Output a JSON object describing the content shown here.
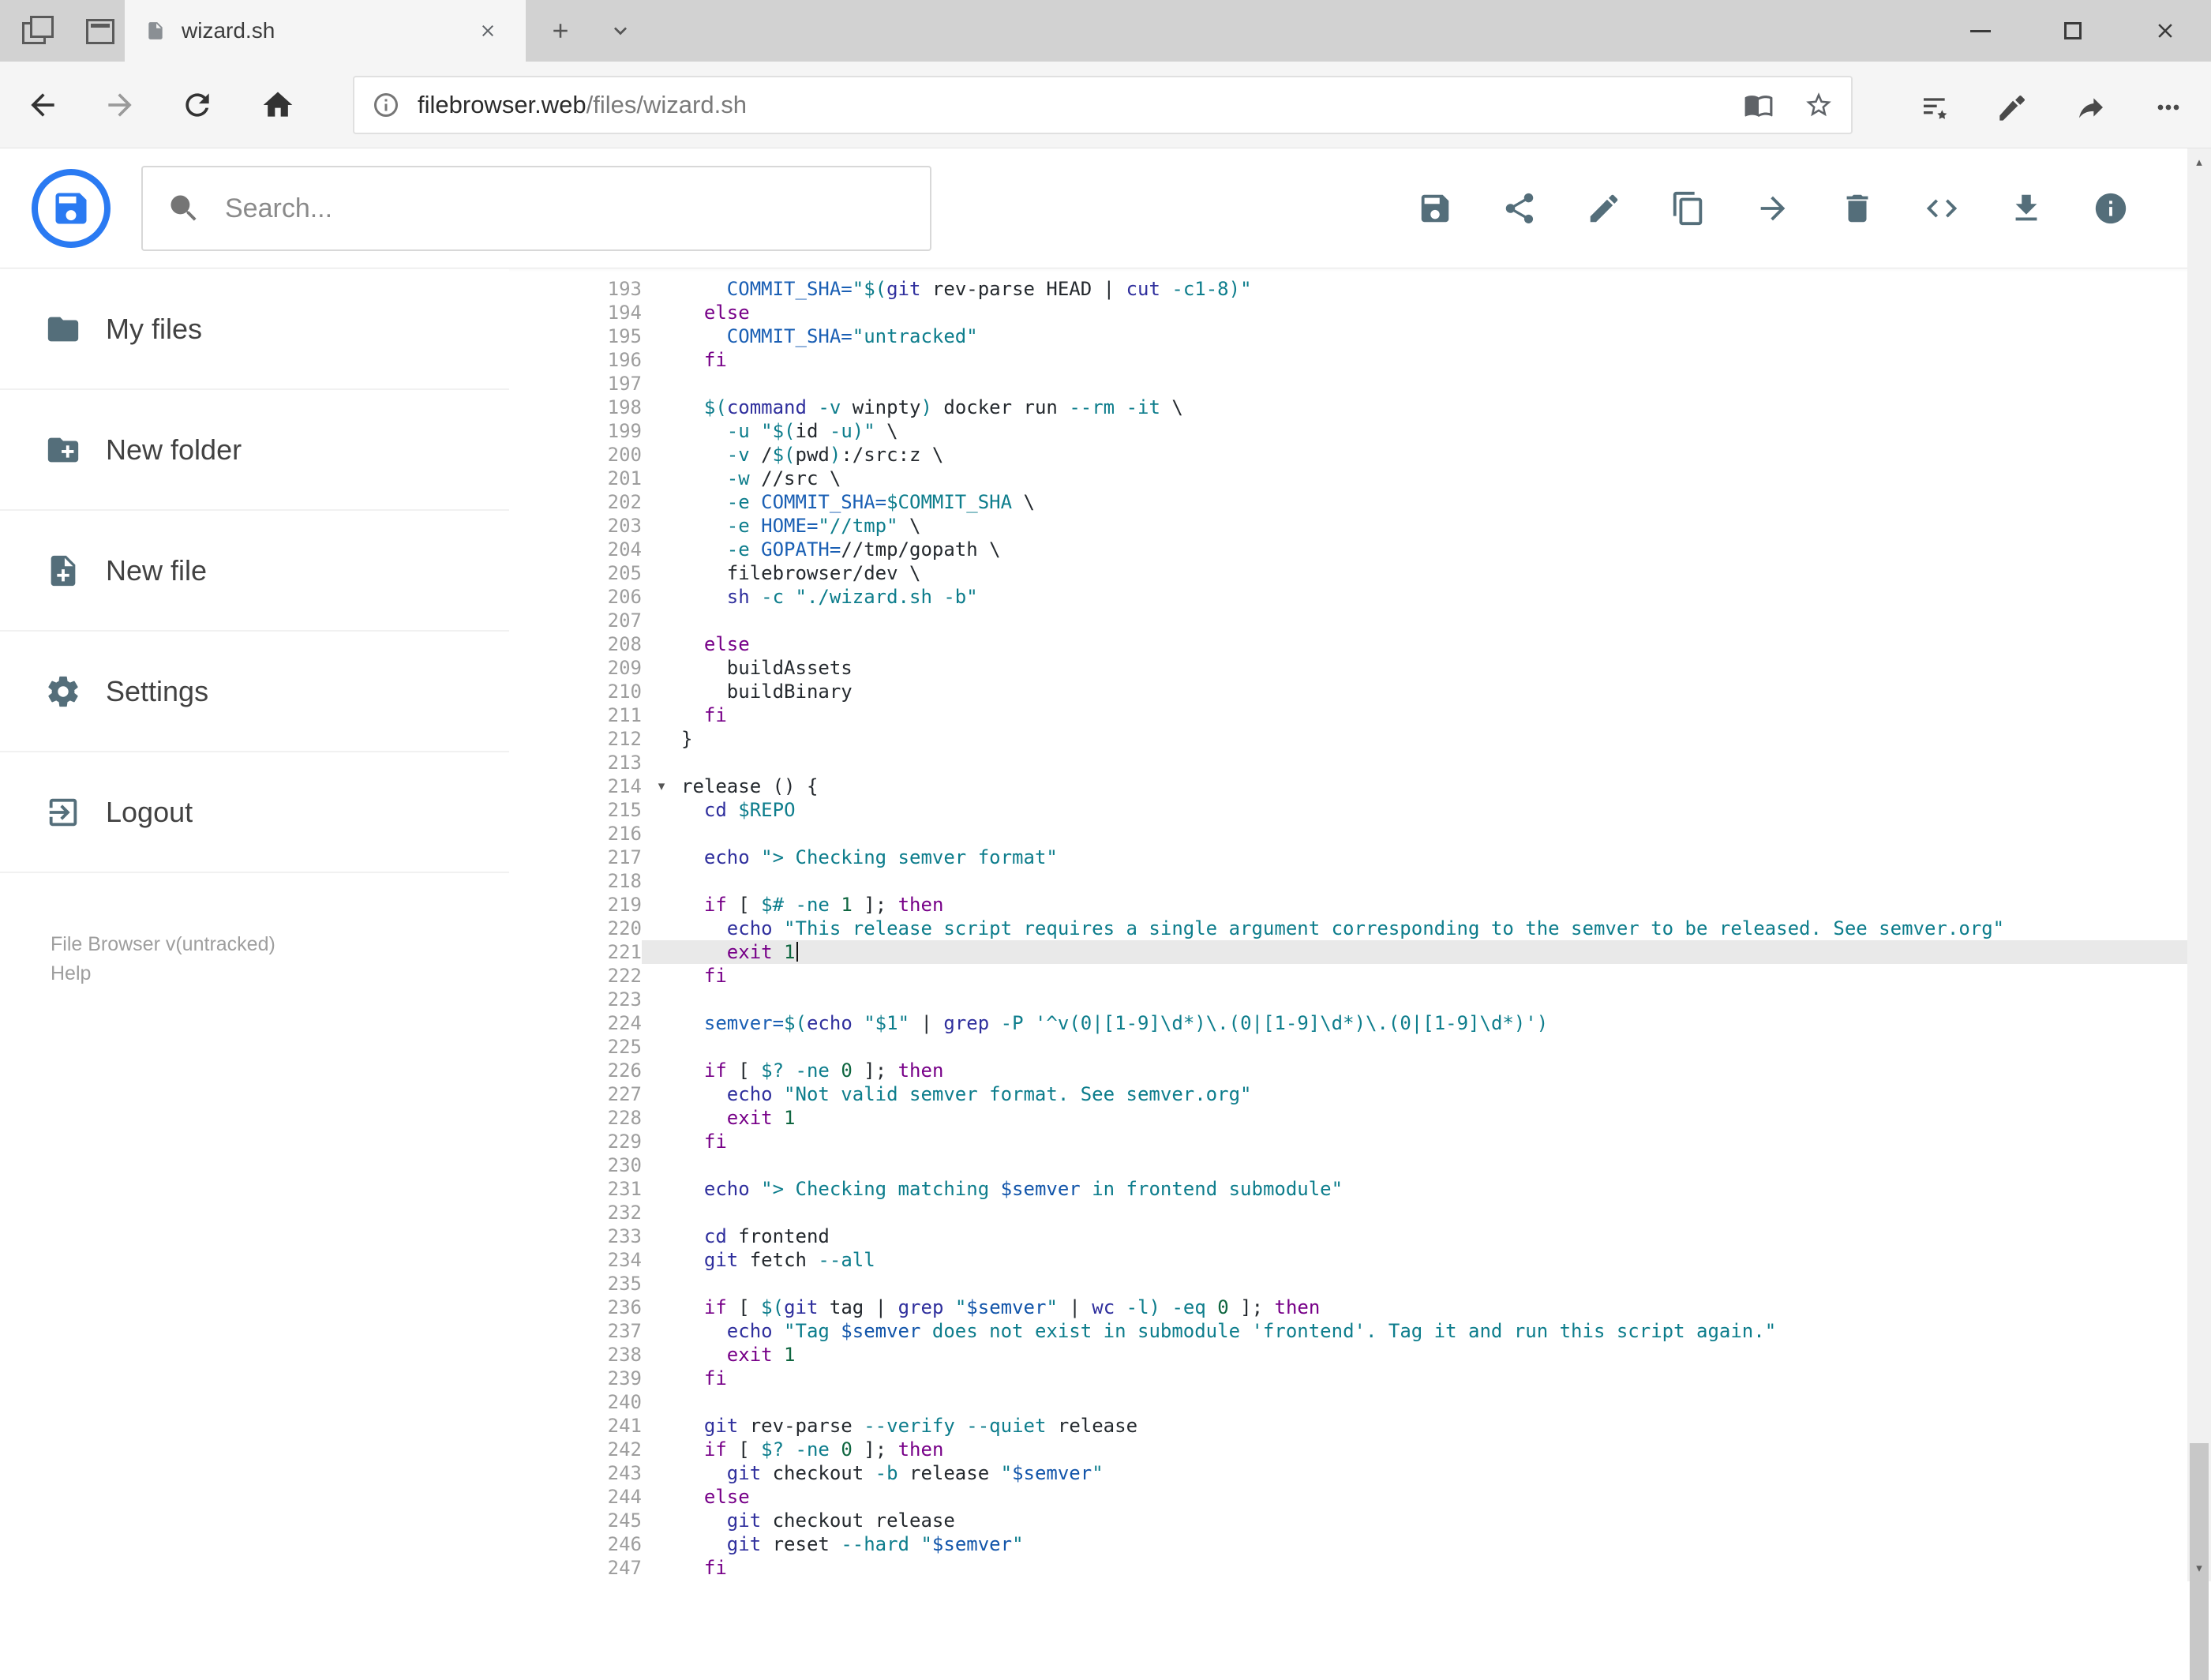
{
  "browser": {
    "tab_title": "wizard.sh",
    "url_host": "filebrowser.web",
    "url_path": "/files/wizard.sh"
  },
  "header": {
    "search_placeholder": "Search...",
    "actions": [
      {
        "name": "save",
        "icon": "save"
      },
      {
        "name": "share",
        "icon": "share"
      },
      {
        "name": "rename",
        "icon": "edit"
      },
      {
        "name": "copy",
        "icon": "copy"
      },
      {
        "name": "move",
        "icon": "move"
      },
      {
        "name": "delete",
        "icon": "delete"
      },
      {
        "name": "editor",
        "icon": "code"
      },
      {
        "name": "download",
        "icon": "download"
      },
      {
        "name": "info",
        "icon": "info"
      }
    ]
  },
  "sidebar": {
    "items": [
      {
        "name": "my-files",
        "icon": "folder",
        "label": "My files"
      },
      {
        "name": "new-folder",
        "icon": "new-folder",
        "label": "New folder"
      },
      {
        "name": "new-file",
        "icon": "new-file",
        "label": "New file"
      },
      {
        "name": "settings",
        "icon": "settings",
        "label": "Settings"
      },
      {
        "name": "logout",
        "icon": "logout",
        "label": "Logout"
      }
    ],
    "footer_version": "File Browser v(untracked)",
    "footer_help": "Help"
  },
  "colors": {
    "accent": "#2a7af2",
    "icon_gray": "#546e7a",
    "active_line_bg": "#e9e9e9",
    "keyword": "#770088",
    "string": "#0d7d8c"
  },
  "editor": {
    "active_line": 221,
    "fold_line": 214,
    "lines": [
      {
        "n": 193,
        "t": [
          [
            "p",
            "    "
          ],
          [
            "d",
            "COMMIT_SHA="
          ],
          [
            "s",
            "\""
          ],
          [
            "v",
            "$("
          ],
          [
            "b",
            "git"
          ],
          [
            "p",
            " rev-parse HEAD | "
          ],
          [
            "b",
            "cut"
          ],
          [
            "p",
            " "
          ],
          [
            "a",
            "-c1-8"
          ],
          [
            "v",
            ")"
          ],
          [
            "s",
            "\""
          ]
        ]
      },
      {
        "n": 194,
        "t": [
          [
            "p",
            "  "
          ],
          [
            "k",
            "else"
          ]
        ]
      },
      {
        "n": 195,
        "t": [
          [
            "p",
            "    "
          ],
          [
            "d",
            "COMMIT_SHA="
          ],
          [
            "s",
            "\"untracked\""
          ]
        ]
      },
      {
        "n": 196,
        "t": [
          [
            "p",
            "  "
          ],
          [
            "k",
            "fi"
          ]
        ]
      },
      {
        "n": 197,
        "t": []
      },
      {
        "n": 198,
        "t": [
          [
            "p",
            "  "
          ],
          [
            "v",
            "$("
          ],
          [
            "b",
            "command"
          ],
          [
            "p",
            " "
          ],
          [
            "a",
            "-v"
          ],
          [
            "p",
            " winpty"
          ],
          [
            "v",
            ")"
          ],
          [
            "p",
            " docker run "
          ],
          [
            "a",
            "--rm"
          ],
          [
            "p",
            " "
          ],
          [
            "a",
            "-it"
          ],
          [
            "p",
            " \\"
          ]
        ]
      },
      {
        "n": 199,
        "t": [
          [
            "p",
            "    "
          ],
          [
            "a",
            "-u"
          ],
          [
            "p",
            " "
          ],
          [
            "s",
            "\""
          ],
          [
            "v",
            "$("
          ],
          [
            "p",
            "id "
          ],
          [
            "a",
            "-u"
          ],
          [
            "v",
            ")"
          ],
          [
            "s",
            "\""
          ],
          [
            "p",
            " \\"
          ]
        ]
      },
      {
        "n": 200,
        "t": [
          [
            "p",
            "    "
          ],
          [
            "a",
            "-v"
          ],
          [
            "p",
            " /"
          ],
          [
            "v",
            "$("
          ],
          [
            "p",
            "pwd"
          ],
          [
            "v",
            ")"
          ],
          [
            "p",
            ":/src:z \\"
          ]
        ]
      },
      {
        "n": 201,
        "t": [
          [
            "p",
            "    "
          ],
          [
            "a",
            "-w"
          ],
          [
            "p",
            " //src \\"
          ]
        ]
      },
      {
        "n": 202,
        "t": [
          [
            "p",
            "    "
          ],
          [
            "a",
            "-e"
          ],
          [
            "p",
            " "
          ],
          [
            "d",
            "COMMIT_SHA="
          ],
          [
            "v",
            "$COMMIT_SHA"
          ],
          [
            "p",
            " \\"
          ]
        ]
      },
      {
        "n": 203,
        "t": [
          [
            "p",
            "    "
          ],
          [
            "a",
            "-e"
          ],
          [
            "p",
            " "
          ],
          [
            "d",
            "HOME="
          ],
          [
            "s",
            "\"//tmp\""
          ],
          [
            "p",
            " \\"
          ]
        ]
      },
      {
        "n": 204,
        "t": [
          [
            "p",
            "    "
          ],
          [
            "a",
            "-e"
          ],
          [
            "p",
            " "
          ],
          [
            "d",
            "GOPATH="
          ],
          [
            "p",
            "//tmp/gopath \\"
          ]
        ]
      },
      {
        "n": 205,
        "t": [
          [
            "p",
            "    filebrowser/dev \\"
          ]
        ]
      },
      {
        "n": 206,
        "t": [
          [
            "p",
            "    "
          ],
          [
            "b",
            "sh"
          ],
          [
            "p",
            " "
          ],
          [
            "a",
            "-c"
          ],
          [
            "p",
            " "
          ],
          [
            "s",
            "\"./wizard.sh -b\""
          ]
        ]
      },
      {
        "n": 207,
        "t": []
      },
      {
        "n": 208,
        "t": [
          [
            "p",
            "  "
          ],
          [
            "k",
            "else"
          ]
        ]
      },
      {
        "n": 209,
        "t": [
          [
            "p",
            "    buildAssets"
          ]
        ]
      },
      {
        "n": 210,
        "t": [
          [
            "p",
            "    buildBinary"
          ]
        ]
      },
      {
        "n": 211,
        "t": [
          [
            "p",
            "  "
          ],
          [
            "k",
            "fi"
          ]
        ]
      },
      {
        "n": 212,
        "t": [
          [
            "p",
            "}"
          ]
        ]
      },
      {
        "n": 213,
        "t": []
      },
      {
        "n": 214,
        "t": [
          [
            "p",
            "release () {"
          ]
        ]
      },
      {
        "n": 215,
        "t": [
          [
            "p",
            "  "
          ],
          [
            "b",
            "cd"
          ],
          [
            "p",
            " "
          ],
          [
            "v",
            "$REPO"
          ]
        ]
      },
      {
        "n": 216,
        "t": []
      },
      {
        "n": 217,
        "t": [
          [
            "p",
            "  "
          ],
          [
            "b",
            "echo"
          ],
          [
            "p",
            " "
          ],
          [
            "s",
            "\"> Checking semver format\""
          ]
        ]
      },
      {
        "n": 218,
        "t": []
      },
      {
        "n": 219,
        "t": [
          [
            "p",
            "  "
          ],
          [
            "k",
            "if"
          ],
          [
            "p",
            " [ "
          ],
          [
            "v",
            "$#"
          ],
          [
            "p",
            " "
          ],
          [
            "a",
            "-ne"
          ],
          [
            "p",
            " "
          ],
          [
            "num",
            "1"
          ],
          [
            "p",
            " ]; "
          ],
          [
            "k",
            "then"
          ]
        ]
      },
      {
        "n": 220,
        "t": [
          [
            "p",
            "    "
          ],
          [
            "b",
            "echo"
          ],
          [
            "p",
            " "
          ],
          [
            "s",
            "\"This release script requires a single argument corresponding to the semver to be released. See semver.org\""
          ]
        ]
      },
      {
        "n": 221,
        "t": [
          [
            "p",
            "    "
          ],
          [
            "k",
            "exit"
          ],
          [
            "p",
            " "
          ],
          [
            "num",
            "1"
          ]
        ]
      },
      {
        "n": 222,
        "t": [
          [
            "p",
            "  "
          ],
          [
            "k",
            "fi"
          ]
        ]
      },
      {
        "n": 223,
        "t": []
      },
      {
        "n": 224,
        "t": [
          [
            "p",
            "  "
          ],
          [
            "d",
            "semver="
          ],
          [
            "v",
            "$("
          ],
          [
            "b",
            "echo"
          ],
          [
            "p",
            " "
          ],
          [
            "s",
            "\"$1\""
          ],
          [
            "p",
            " | "
          ],
          [
            "b",
            "grep"
          ],
          [
            "p",
            " "
          ],
          [
            "a",
            "-P"
          ],
          [
            "p",
            " "
          ],
          [
            "s",
            "'^v(0|[1-9]\\d*)\\.(0|[1-9]\\d*)\\.(0|[1-9]\\d*)'"
          ],
          [
            "v",
            ")"
          ]
        ]
      },
      {
        "n": 225,
        "t": []
      },
      {
        "n": 226,
        "t": [
          [
            "p",
            "  "
          ],
          [
            "k",
            "if"
          ],
          [
            "p",
            " [ "
          ],
          [
            "v",
            "$?"
          ],
          [
            "p",
            " "
          ],
          [
            "a",
            "-ne"
          ],
          [
            "p",
            " "
          ],
          [
            "num",
            "0"
          ],
          [
            "p",
            " ]; "
          ],
          [
            "k",
            "then"
          ]
        ]
      },
      {
        "n": 227,
        "t": [
          [
            "p",
            "    "
          ],
          [
            "b",
            "echo"
          ],
          [
            "p",
            " "
          ],
          [
            "s",
            "\"Not valid semver format. See semver.org\""
          ]
        ]
      },
      {
        "n": 228,
        "t": [
          [
            "p",
            "    "
          ],
          [
            "k",
            "exit"
          ],
          [
            "p",
            " "
          ],
          [
            "num",
            "1"
          ]
        ]
      },
      {
        "n": 229,
        "t": [
          [
            "p",
            "  "
          ],
          [
            "k",
            "fi"
          ]
        ]
      },
      {
        "n": 230,
        "t": []
      },
      {
        "n": 231,
        "t": [
          [
            "p",
            "  "
          ],
          [
            "b",
            "echo"
          ],
          [
            "p",
            " "
          ],
          [
            "s",
            "\"> Checking matching "
          ],
          [
            "v2",
            "$semver"
          ],
          [
            "s",
            " in frontend submodule\""
          ]
        ]
      },
      {
        "n": 232,
        "t": []
      },
      {
        "n": 233,
        "t": [
          [
            "p",
            "  "
          ],
          [
            "b",
            "cd"
          ],
          [
            "p",
            " frontend"
          ]
        ]
      },
      {
        "n": 234,
        "t": [
          [
            "p",
            "  "
          ],
          [
            "b",
            "git"
          ],
          [
            "p",
            " fetch "
          ],
          [
            "a",
            "--all"
          ]
        ]
      },
      {
        "n": 235,
        "t": []
      },
      {
        "n": 236,
        "t": [
          [
            "p",
            "  "
          ],
          [
            "k",
            "if"
          ],
          [
            "p",
            " [ "
          ],
          [
            "v",
            "$("
          ],
          [
            "b",
            "git"
          ],
          [
            "p",
            " tag | "
          ],
          [
            "b",
            "grep"
          ],
          [
            "p",
            " "
          ],
          [
            "s",
            "\""
          ],
          [
            "v2",
            "$semver"
          ],
          [
            "s",
            "\""
          ],
          [
            "p",
            " | "
          ],
          [
            "b",
            "wc"
          ],
          [
            "p",
            " "
          ],
          [
            "a",
            "-l"
          ],
          [
            "v",
            ")"
          ],
          [
            "p",
            " "
          ],
          [
            "a",
            "-eq"
          ],
          [
            "p",
            " "
          ],
          [
            "num",
            "0"
          ],
          [
            "p",
            " ]; "
          ],
          [
            "k",
            "then"
          ]
        ]
      },
      {
        "n": 237,
        "t": [
          [
            "p",
            "    "
          ],
          [
            "b",
            "echo"
          ],
          [
            "p",
            " "
          ],
          [
            "s",
            "\"Tag "
          ],
          [
            "v2",
            "$semver"
          ],
          [
            "s",
            " does not exist in submodule 'frontend'. Tag it and run this script again.\""
          ]
        ]
      },
      {
        "n": 238,
        "t": [
          [
            "p",
            "    "
          ],
          [
            "k",
            "exit"
          ],
          [
            "p",
            " "
          ],
          [
            "num",
            "1"
          ]
        ]
      },
      {
        "n": 239,
        "t": [
          [
            "p",
            "  "
          ],
          [
            "k",
            "fi"
          ]
        ]
      },
      {
        "n": 240,
        "t": []
      },
      {
        "n": 241,
        "t": [
          [
            "p",
            "  "
          ],
          [
            "b",
            "git"
          ],
          [
            "p",
            " rev-parse "
          ],
          [
            "a",
            "--verify"
          ],
          [
            "p",
            " "
          ],
          [
            "a",
            "--quiet"
          ],
          [
            "p",
            " release"
          ]
        ]
      },
      {
        "n": 242,
        "t": [
          [
            "p",
            "  "
          ],
          [
            "k",
            "if"
          ],
          [
            "p",
            " [ "
          ],
          [
            "v",
            "$?"
          ],
          [
            "p",
            " "
          ],
          [
            "a",
            "-ne"
          ],
          [
            "p",
            " "
          ],
          [
            "num",
            "0"
          ],
          [
            "p",
            " ]; "
          ],
          [
            "k",
            "then"
          ]
        ]
      },
      {
        "n": 243,
        "t": [
          [
            "p",
            "    "
          ],
          [
            "b",
            "git"
          ],
          [
            "p",
            " checkout "
          ],
          [
            "a",
            "-b"
          ],
          [
            "p",
            " release "
          ],
          [
            "s",
            "\""
          ],
          [
            "v2",
            "$semver"
          ],
          [
            "s",
            "\""
          ]
        ]
      },
      {
        "n": 244,
        "t": [
          [
            "p",
            "  "
          ],
          [
            "k",
            "else"
          ]
        ]
      },
      {
        "n": 245,
        "t": [
          [
            "p",
            "    "
          ],
          [
            "b",
            "git"
          ],
          [
            "p",
            " checkout release"
          ]
        ]
      },
      {
        "n": 246,
        "t": [
          [
            "p",
            "    "
          ],
          [
            "b",
            "git"
          ],
          [
            "p",
            " reset "
          ],
          [
            "a",
            "--hard"
          ],
          [
            "p",
            " "
          ],
          [
            "s",
            "\""
          ],
          [
            "v2",
            "$semver"
          ],
          [
            "s",
            "\""
          ]
        ]
      },
      {
        "n": 247,
        "t": [
          [
            "p",
            "  "
          ],
          [
            "k",
            "fi"
          ]
        ]
      }
    ]
  }
}
